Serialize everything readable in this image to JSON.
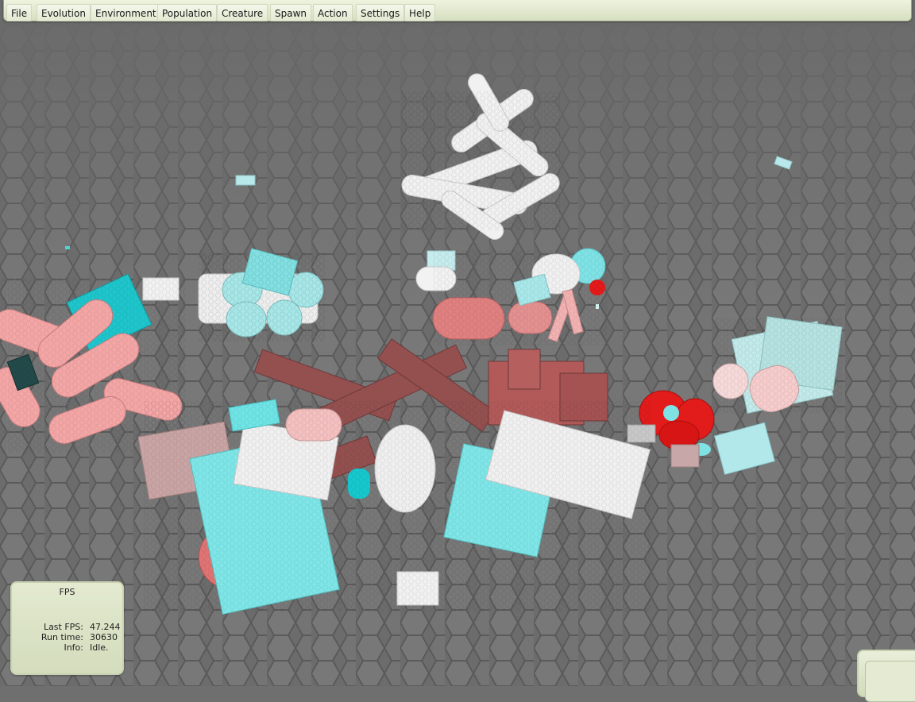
{
  "menu": {
    "items": [
      "File",
      "Evolution",
      "Environment",
      "Population",
      "Creature",
      "Spawn",
      "Action",
      "Settings",
      "Help"
    ]
  },
  "fps_panel": {
    "title": "FPS",
    "last_fps_label": "Last FPS:",
    "last_fps_value": "47.244",
    "run_time_label": "Run time:",
    "run_time_value": "30630",
    "info_label": "Info:",
    "info_value": "Idle."
  },
  "colors": {
    "floor": "#6f6f6f",
    "cyan": "#6fe8e8",
    "pink": "#f2a0a0",
    "white": "#eeeeee",
    "brown": "#9a4e4e",
    "red": "#e01818"
  }
}
